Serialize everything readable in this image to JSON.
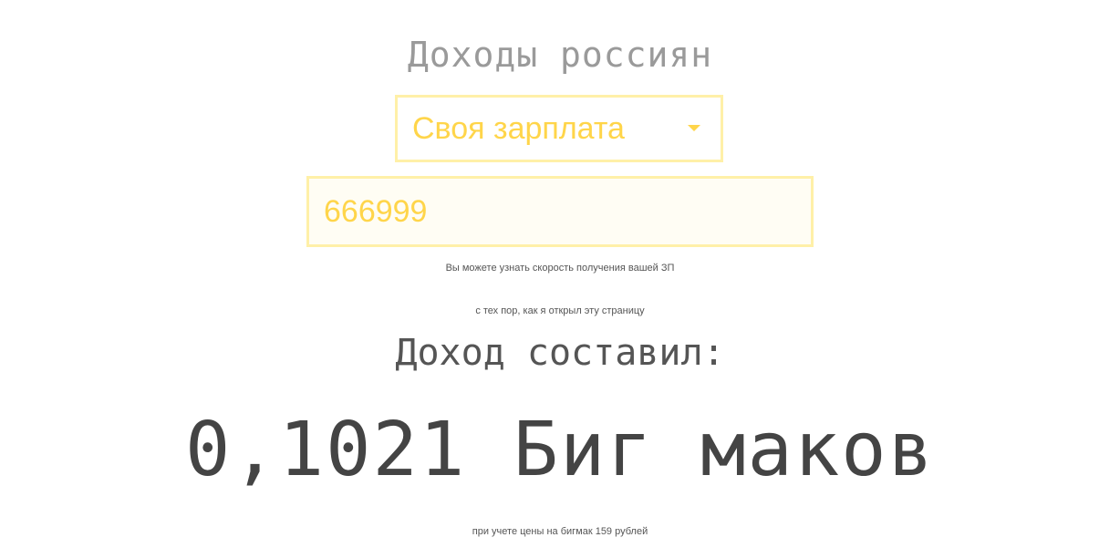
{
  "header": {
    "title": "Доходы россиян"
  },
  "income_select": {
    "selected": "Своя зарплата",
    "icon": "chevron-down-icon"
  },
  "salary_input": {
    "value": "666999"
  },
  "hints": {
    "speed_hint": "Вы можете узнать скорость получения вашей ЗП",
    "since_open": "с тех пор, как я открыл эту страницу"
  },
  "result": {
    "label": "Доход составил:",
    "value": "0,1021 Биг маков",
    "footnote": "при учете цены на бигмак 159 рублей"
  },
  "colors": {
    "accent": "#ffd54a",
    "accent_border": "#fff0a8",
    "title_gray": "#9a9a9a",
    "text_dark": "#444444"
  }
}
